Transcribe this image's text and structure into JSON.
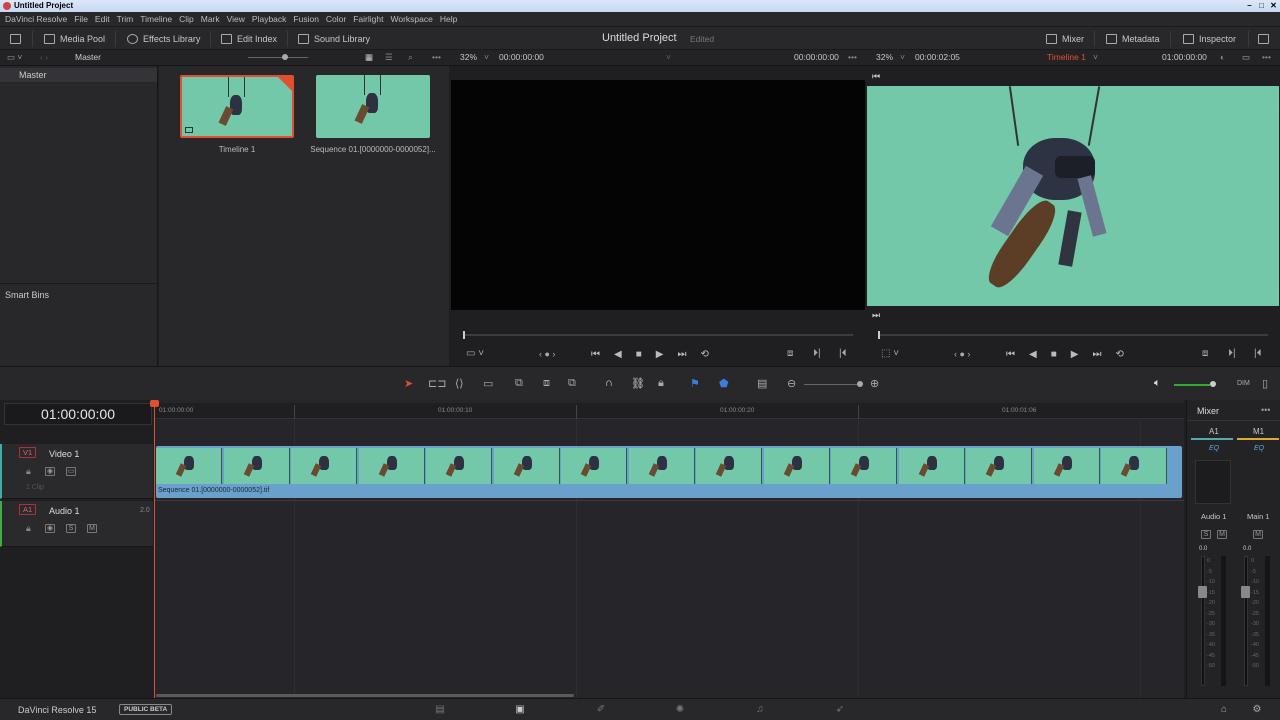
{
  "window": {
    "title": "Untitled Project"
  },
  "menu": [
    "DaVinci Resolve",
    "File",
    "Edit",
    "Trim",
    "Timeline",
    "Clip",
    "Mark",
    "View",
    "Playback",
    "Fusion",
    "Color",
    "Fairlight",
    "Workspace",
    "Help"
  ],
  "toolbar": {
    "media_pool": "Media Pool",
    "effects_library": "Effects Library",
    "edit_index": "Edit Index",
    "sound_library": "Sound Library",
    "project_title": "Untitled Project",
    "project_status": "Edited",
    "mixer": "Mixer",
    "metadata": "Metadata",
    "inspector": "Inspector"
  },
  "subbar": {
    "bin_name": "Master",
    "src_zoom": "32%",
    "src_tc_left": "00:00:00:00",
    "src_tc_right": "00:00:00:00",
    "tl_zoom": "32%",
    "tl_tc_left": "00:00:02:05",
    "timeline_name": "Timeline 1",
    "tl_tc_right": "01:00:00:00"
  },
  "bins": {
    "master": "Master",
    "smart_bins": "Smart Bins"
  },
  "clips": [
    {
      "name": "Timeline 1",
      "selected": true
    },
    {
      "name": "Sequence 01.[0000000-0000052]..."
    }
  ],
  "timeline": {
    "timecode": "01:00:00:00",
    "ruler": [
      "01:00:00:00",
      "01:00:00:10",
      "01:00:00:20",
      "01:00:01:06"
    ],
    "clip_label": "Sequence 01.[0000000-0000052].tif",
    "video_track": {
      "tag": "V1",
      "name": "Video 1",
      "sub": "1 Clip"
    },
    "audio_track": {
      "tag": "A1",
      "name": "Audio 1",
      "level": "2.0"
    },
    "track_btn_s": "S",
    "track_btn_m": "M"
  },
  "mixer": {
    "title": "Mixer",
    "ch1": "A1",
    "ch2": "M1",
    "eq": "EQ",
    "ch1_name": "Audio 1",
    "ch2_name": "Main 1",
    "s": "S",
    "m": "M",
    "ch1_level": "0.0",
    "ch2_level": "0.0",
    "scale": [
      "0",
      "-5",
      "-10",
      "-15",
      "-20",
      "-25",
      "-30",
      "-35",
      "-40",
      "-45",
      "-50"
    ]
  },
  "status": {
    "app": "DaVinci Resolve 15",
    "badge": "PUBLIC BETA"
  },
  "colors": {
    "accent_red": "#e05030",
    "green_screen": "#72c8a8",
    "clip_blue": "#6aa0cc"
  }
}
